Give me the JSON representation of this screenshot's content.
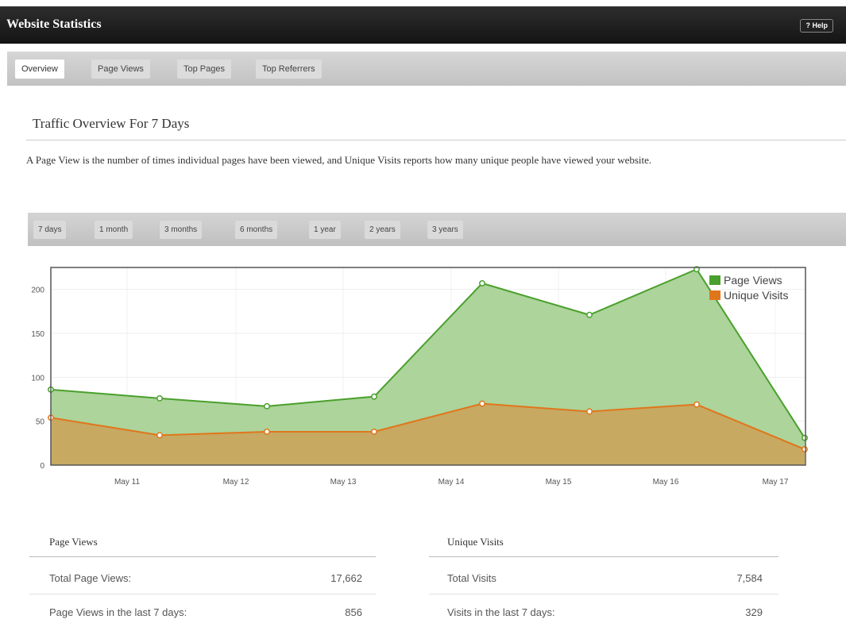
{
  "header": {
    "title": "Website Statistics",
    "help_label": "? Help"
  },
  "tabs": [
    {
      "label": "Overview",
      "active": true
    },
    {
      "label": "Page Views"
    },
    {
      "label": "Top Pages"
    },
    {
      "label": "Top Referrers"
    }
  ],
  "section": {
    "title": "Traffic Overview For 7 Days",
    "description": "A Page View is the number of times individual pages have been viewed, and Unique Visits reports how many unique people have viewed your website."
  },
  "ranges": [
    "7 days",
    "1 month",
    "3 months",
    "6 months",
    "1 year",
    "2 years",
    "3 years"
  ],
  "chart_data": {
    "type": "area",
    "x_tick_labels": [
      "May 11",
      "May 12",
      "May 13",
      "May 14",
      "May 15",
      "May 16",
      "May 17"
    ],
    "y_ticks": [
      0,
      50,
      100,
      150,
      200
    ],
    "ylim": [
      0,
      225
    ],
    "series": [
      {
        "name": "Page Views",
        "color": "#4aa02c",
        "fill": "#a8d296",
        "values": [
          86,
          76,
          67,
          78,
          207,
          171,
          223,
          31
        ]
      },
      {
        "name": "Unique Visits",
        "color": "#e0761c",
        "fill": "#c8a65e",
        "values": [
          54,
          34,
          38,
          38,
          70,
          61,
          69,
          18
        ]
      }
    ],
    "legend_position": "top-right",
    "grid": true
  },
  "stats": {
    "page_views": {
      "heading": "Page Views",
      "rows": [
        {
          "label": "Total Page Views:",
          "value": "17,662"
        },
        {
          "label": "Page Views in the last 7 days:",
          "value": "856"
        }
      ]
    },
    "unique_visits": {
      "heading": "Unique Visits",
      "rows": [
        {
          "label": "Total Visits",
          "value": "7,584"
        },
        {
          "label": "Visits in the last 7 days:",
          "value": "329"
        }
      ]
    }
  }
}
